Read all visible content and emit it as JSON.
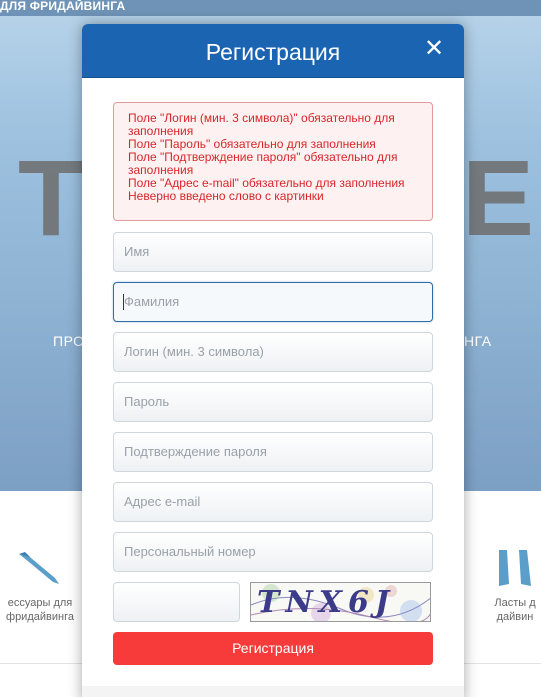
{
  "background": {
    "topbar_text": "ДЛЯ ФРИДАЙВИНГА",
    "big_left": "T",
    "big_right": "E",
    "tagline_left": "ПРО",
    "tagline_right": "НГА",
    "cat_left": {
      "line1": "ессуары для",
      "line2": "фридайвинга",
      "icon": "knife-icon"
    },
    "cat_right": {
      "line1": "Ласты д",
      "line2": "дайвин",
      "icon": "fins-icon"
    }
  },
  "modal": {
    "title": "Регистрация",
    "close_label": "✕",
    "errors": [
      "Поле \"Логин (мин. 3 символа)\" обязательно для заполнения",
      "Поле \"Пароль\" обязательно для заполнения",
      "Поле \"Подтверждение пароля\" обязательно для заполнения",
      "Поле \"Адрес e-mail\" обязательно для заполнения",
      "Неверно введено слово с картинки"
    ],
    "fields": {
      "first_name": {
        "placeholder": "Имя",
        "value": ""
      },
      "last_name": {
        "placeholder": "Фамилия",
        "value": ""
      },
      "login": {
        "placeholder": "Логин (мин. 3 символа)",
        "value": ""
      },
      "password": {
        "placeholder": "Пароль",
        "value": ""
      },
      "password_confirm": {
        "placeholder": "Подтверждение пароля",
        "value": ""
      },
      "email": {
        "placeholder": "Адрес e-mail",
        "value": ""
      },
      "personal_number": {
        "placeholder": "Персональный номер",
        "value": ""
      },
      "captcha": {
        "value": ""
      }
    },
    "captcha_text": "TNX6J",
    "submit_label": "Регистрация"
  },
  "colors": {
    "header": "#1a64b2",
    "submit": "#f73b3b",
    "error_text": "#d8262a",
    "error_border": "#e59a9a"
  }
}
